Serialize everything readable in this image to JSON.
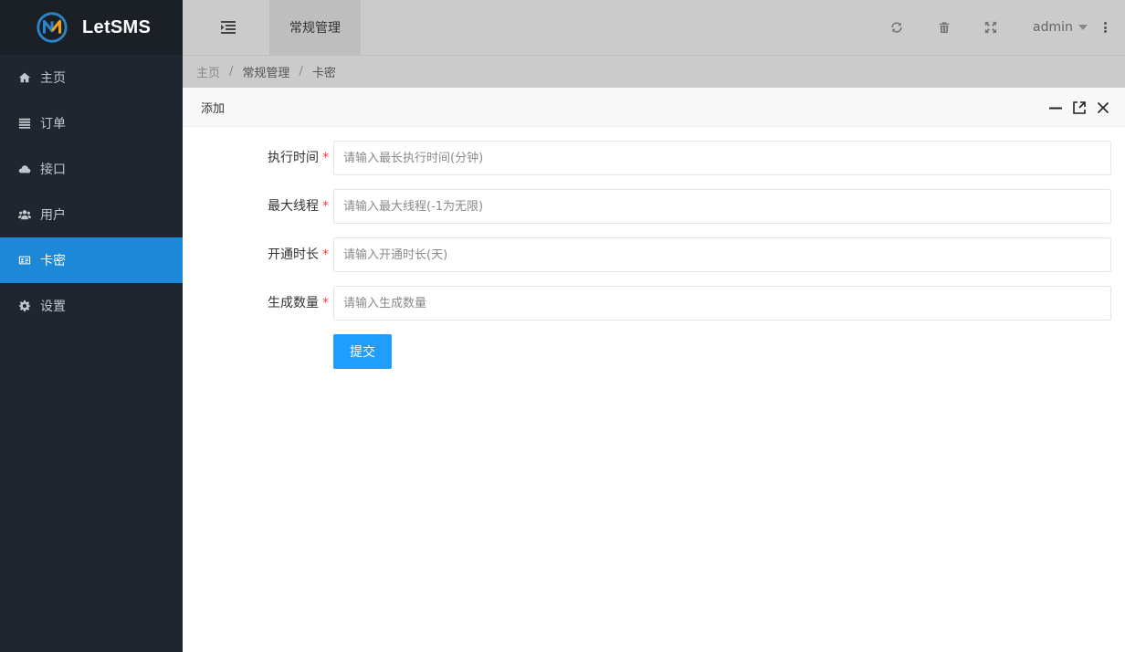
{
  "app": {
    "name": "LetSMS"
  },
  "sidebar": {
    "items": [
      {
        "label": "主页",
        "icon": "home-icon",
        "active": false
      },
      {
        "label": "订单",
        "icon": "list-icon",
        "active": false
      },
      {
        "label": "接口",
        "icon": "cloud-icon",
        "active": false
      },
      {
        "label": "用户",
        "icon": "users-icon",
        "active": false
      },
      {
        "label": "卡密",
        "icon": "card-icon",
        "active": true
      },
      {
        "label": "设置",
        "icon": "gear-icon",
        "active": false
      }
    ]
  },
  "header": {
    "tab_label": "常规管理",
    "user_name": "admin"
  },
  "breadcrumb": {
    "items": [
      "主页",
      "常规管理",
      "卡密"
    ],
    "separator": "/"
  },
  "dialog": {
    "title": "添加",
    "fields": [
      {
        "label": "执行时间",
        "required_mark": "*",
        "placeholder": "请输入最长执行时间(分钟)",
        "value": ""
      },
      {
        "label": "最大线程",
        "required_mark": "*",
        "placeholder": "请输入最大线程(-1为无限)",
        "value": ""
      },
      {
        "label": "开通时长",
        "required_mark": "*",
        "placeholder": "请输入开通时长(天)",
        "value": ""
      },
      {
        "label": "生成数量",
        "required_mark": "*",
        "placeholder": "请输入生成数量",
        "value": ""
      }
    ],
    "submit_label": "提交"
  },
  "colors": {
    "sidebar_bg": "#20262f",
    "active_item": "#1e88d8",
    "primary_button": "#1e9fff",
    "required_mark": "#ff3b3b"
  }
}
